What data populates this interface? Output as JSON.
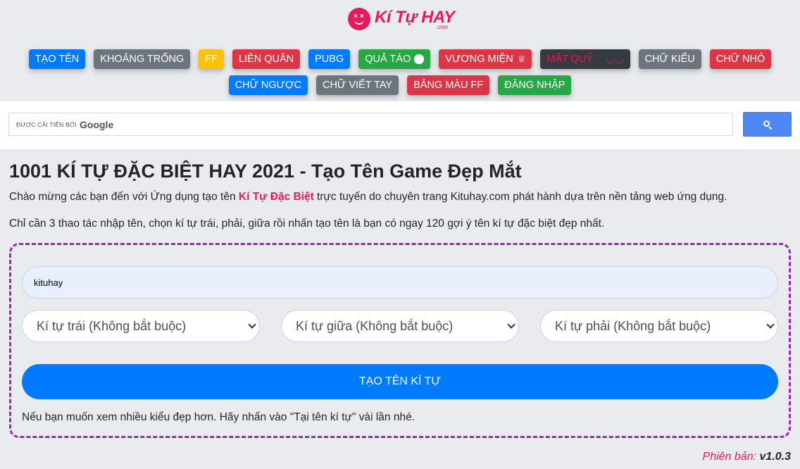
{
  "brand": {
    "name_part1": "Kí Tự ",
    "name_part2": "HAY",
    "suffix": ".com",
    "logo_eye": "×",
    "color": "#e8195a"
  },
  "nav": {
    "row1": [
      {
        "label": "TẠO TÊN",
        "color": "blue"
      },
      {
        "label": "KHOẢNG TRỐNG",
        "color": "gray"
      },
      {
        "label": "FF",
        "color": "yellow"
      },
      {
        "label": "LIÊN QUÂN",
        "color": "red"
      },
      {
        "label": "PUBG",
        "color": "blue"
      },
      {
        "label": "QUẢ TÁO",
        "color": "green",
        "icon": "apple-icon"
      },
      {
        "label": "VƯƠNG MIỆN",
        "color": "red",
        "icon": "crown-icon",
        "icon_glyph": "♕"
      },
      {
        "label": "MẶT QUỶ",
        "color": "dark",
        "extra": "◡◡"
      },
      {
        "label": "CHỮ KIỂU",
        "color": "gray"
      },
      {
        "label": "CHỮ NHỎ",
        "color": "red"
      }
    ],
    "row2": [
      {
        "label": "CHỮ NGƯỢC",
        "color": "blue"
      },
      {
        "label": "CHỮ VIẾT TAY",
        "color": "gray"
      },
      {
        "label": "BẢNG MÀU FF",
        "color": "red"
      },
      {
        "label": "ĐĂNG NHẬP",
        "color": "green"
      }
    ]
  },
  "search": {
    "powered_by": "ĐƯỢC CẢI TIẾN BỞI",
    "provider": "Google",
    "query": ""
  },
  "page": {
    "title": "1001 KÍ TỰ ĐẶC BIỆT HAY 2021 - Tạo Tên Game Đẹp Mắt",
    "intro_before": "Chào mừng các bạn đến với Ứng dụng tạo tên ",
    "intro_highlight": "Kí Tự Đặc Biệt",
    "intro_after": " trực tuyến do chuyên trang Kituhay.com phát hành dựa trên nền tảng web ứng dụng.",
    "instructions": "Chỉ cần 3 thao tác nhập tên, chọn kí tự trái, phải, giữa rồi nhấn tạo tên là bạn có ngay 120 gợi ý tên kí tự đặc biệt đẹp nhất."
  },
  "form": {
    "name_value": "kituhay",
    "select_left": "Kí tự trái (Không bắt buộc)",
    "select_middle": "Kí tự giữa (Không bắt buộc)",
    "select_right": "Kí tự phải (Không bắt buộc)",
    "submit_label": "TẠO TÊN KÍ TỰ",
    "hint": "Nếu bạn muốn xem nhiều kiểu đẹp hơn. Hãy nhấn vào \"Tại tên kí tự\" vài lần nhé."
  },
  "footer": {
    "version_label": "Phiên bản:",
    "version_number": "v1.0.3"
  }
}
